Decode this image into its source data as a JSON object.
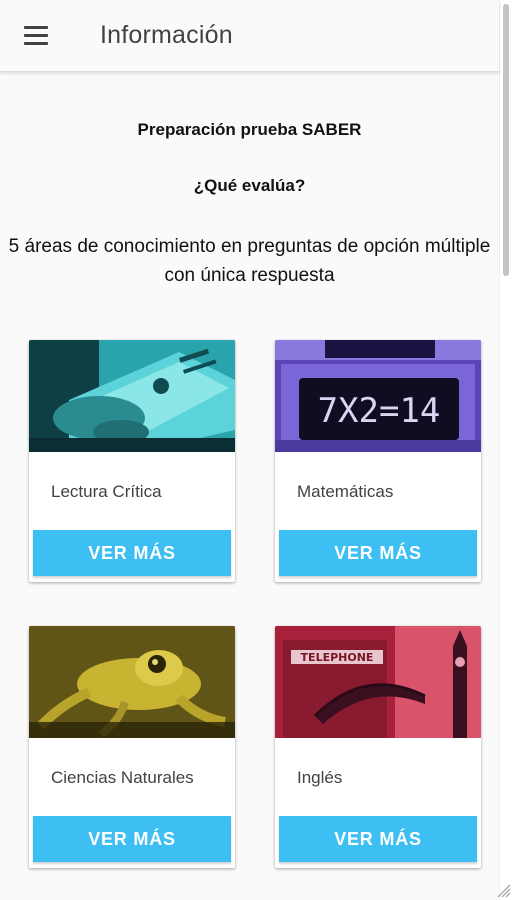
{
  "app_bar": {
    "title": "Información"
  },
  "info": {
    "heading": "Preparación prueba SABER",
    "question": "¿Qué evalúa?",
    "description": "5 áreas de conocimiento en preguntas de opción múltiple con única respuesta"
  },
  "cards": [
    {
      "label": "Lectura Crítica",
      "button": "VER MÁS",
      "image": "book-reading-photo"
    },
    {
      "label": "Matemáticas",
      "button": "VER MÁS",
      "image": "math-board-photo",
      "image_text": "7X2=14"
    },
    {
      "label": "Ciencias Naturales",
      "button": "VER MÁS",
      "image": "frog-photo"
    },
    {
      "label": "Inglés",
      "button": "VER MÁS",
      "image": "london-phone-booth-photo",
      "image_text": "TELEPHONE"
    }
  ],
  "colors": {
    "button": "#3ebff3",
    "card_1_tint": "#2fb2b8",
    "card_2_tint": "#6a4ec8",
    "card_3_tint": "#c9b432",
    "card_4_tint": "#c8344b"
  }
}
